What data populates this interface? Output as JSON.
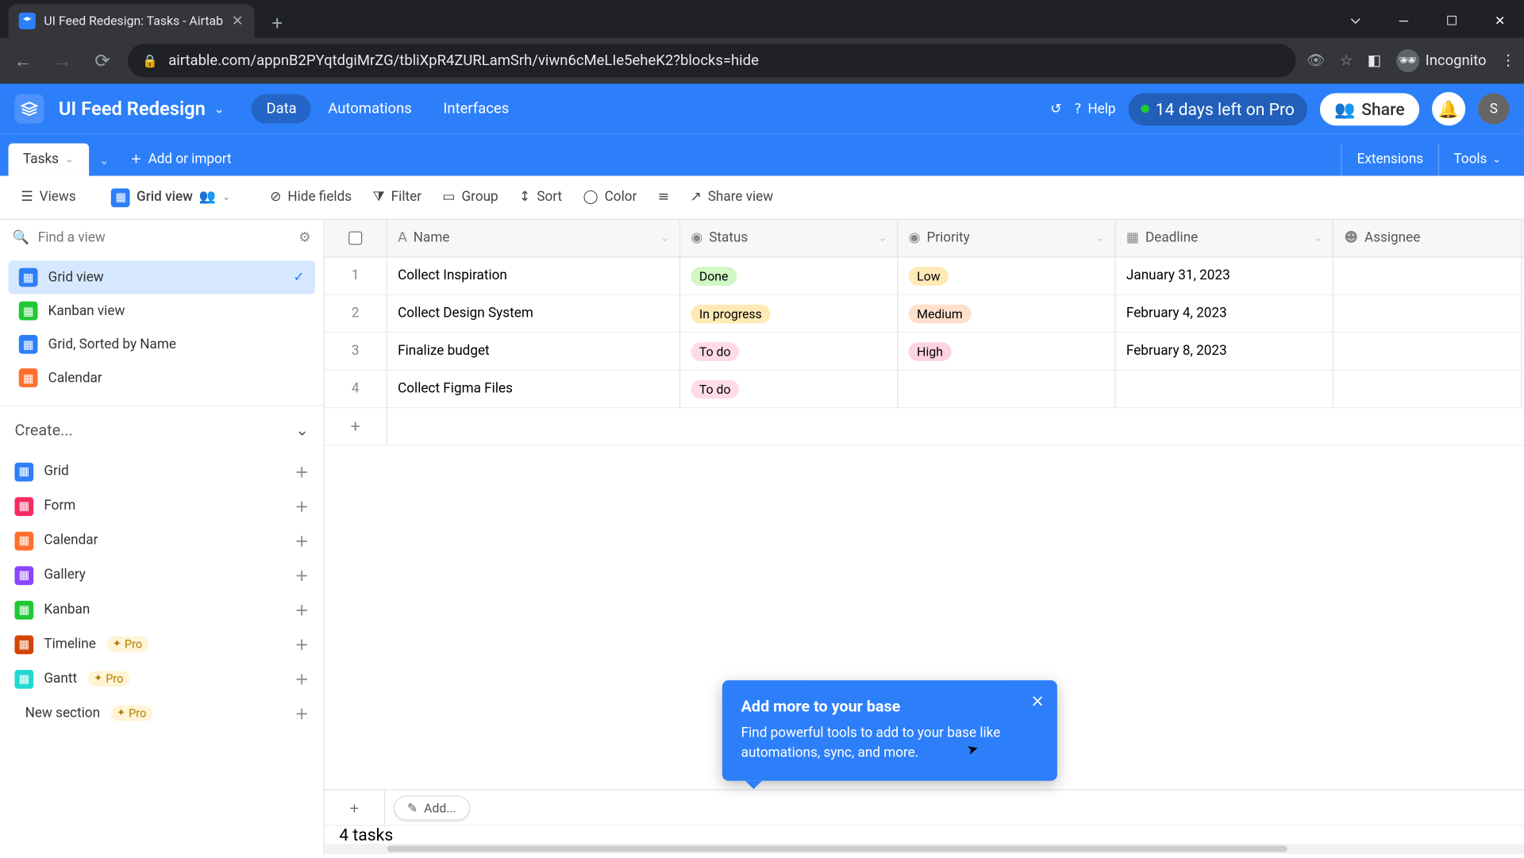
{
  "browser": {
    "tab_title": "UI Feed Redesign: Tasks - Airtab",
    "url": "airtable.com/appnB2PYqtdgiMrZG/tbliXpR4ZURLamSrh/viwn6cMeLIe5eheK2?blocks=hide",
    "incognito_label": "Incognito"
  },
  "header": {
    "base_name": "UI Feed Redesign",
    "tabs": {
      "data": "Data",
      "automations": "Automations",
      "interfaces": "Interfaces"
    },
    "help": "Help",
    "trial": "14 days left on Pro",
    "share": "Share",
    "avatar": "S"
  },
  "table_bar": {
    "active_table": "Tasks",
    "add_import": "Add or import",
    "extensions": "Extensions",
    "tools": "Tools"
  },
  "toolbar": {
    "views": "Views",
    "view_name": "Grid view",
    "hide_fields": "Hide fields",
    "filter": "Filter",
    "group": "Group",
    "sort": "Sort",
    "color": "Color",
    "share_view": "Share view"
  },
  "sidebar": {
    "search_placeholder": "Find a view",
    "views": [
      {
        "label": "Grid view",
        "color": "ic-blue",
        "active": true
      },
      {
        "label": "Kanban view",
        "color": "ic-green",
        "active": false
      },
      {
        "label": "Grid, Sorted by Name",
        "color": "ic-blue",
        "active": false
      },
      {
        "label": "Calendar",
        "color": "ic-orange",
        "active": false
      }
    ],
    "create_label": "Create...",
    "create": [
      {
        "label": "Grid",
        "color": "ic-blue",
        "pro": false
      },
      {
        "label": "Form",
        "color": "ic-pink",
        "pro": false
      },
      {
        "label": "Calendar",
        "color": "ic-orange",
        "pro": false
      },
      {
        "label": "Gallery",
        "color": "ic-purple",
        "pro": false
      },
      {
        "label": "Kanban",
        "color": "ic-green",
        "pro": false
      },
      {
        "label": "Timeline",
        "color": "ic-brown",
        "pro": true
      },
      {
        "label": "Gantt",
        "color": "ic-teal",
        "pro": true
      }
    ],
    "new_section": "New section",
    "pro_label": "Pro"
  },
  "columns": {
    "name": "Name",
    "status": "Status",
    "priority": "Priority",
    "deadline": "Deadline",
    "assignee": "Assignee"
  },
  "rows": [
    {
      "n": "1",
      "name": "Collect Inspiration",
      "status": "Done",
      "status_c": "tag-done",
      "prio": "Low",
      "prio_c": "tag-low",
      "dead": "January 31, 2023"
    },
    {
      "n": "2",
      "name": "Collect Design System",
      "status": "In progress",
      "status_c": "tag-prog",
      "prio": "Medium",
      "prio_c": "tag-med",
      "dead": "February 4, 2023"
    },
    {
      "n": "3",
      "name": "Finalize budget",
      "status": "To do",
      "status_c": "tag-todo",
      "prio": "High",
      "prio_c": "tag-high",
      "dead": "February 8, 2023"
    },
    {
      "n": "4",
      "name": "Collect Figma Files",
      "status": "To do",
      "status_c": "tag-todo",
      "prio": "",
      "prio_c": "",
      "dead": ""
    }
  ],
  "footer": {
    "add": "Add...",
    "count": "4 tasks"
  },
  "popover": {
    "title": "Add more to your base",
    "body": "Find powerful tools to add to your base like automations, sync, and more."
  }
}
